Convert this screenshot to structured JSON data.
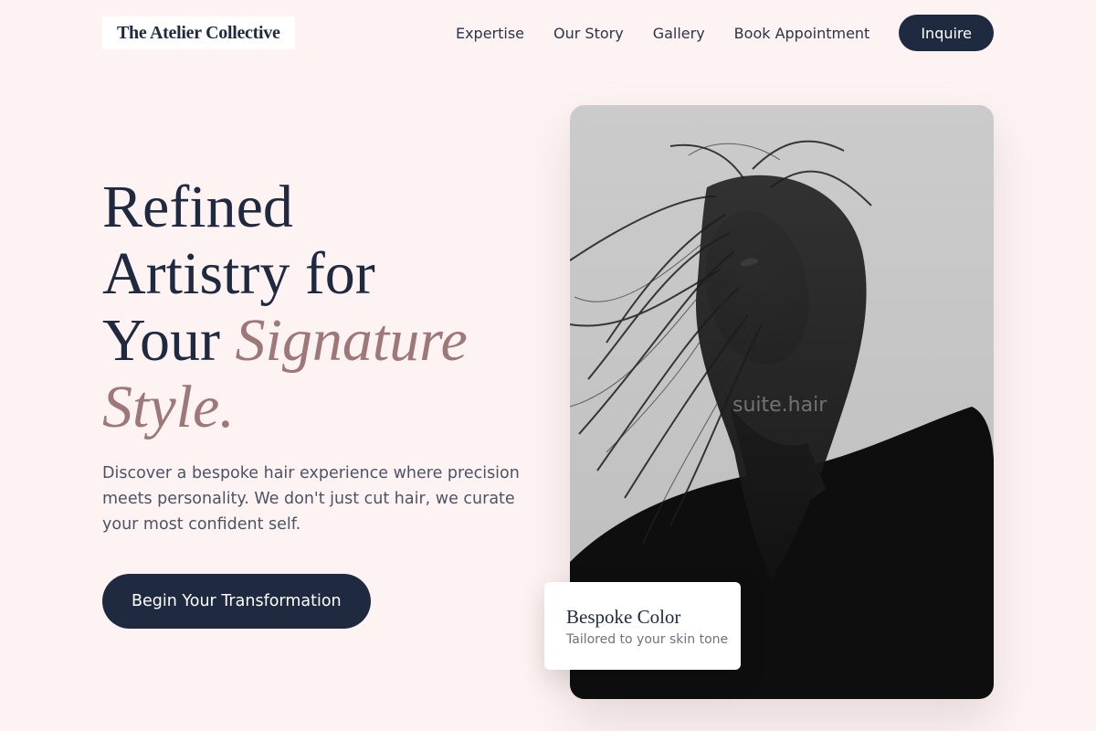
{
  "header": {
    "logo": "The Atelier Collective",
    "nav": [
      "Expertise",
      "Our Story",
      "Gallery",
      "Book Appointment"
    ],
    "cta_label": "Inquire"
  },
  "hero": {
    "title_lines": {
      "line1": "Refined",
      "line2": "Artistry for",
      "line3_plain": "Your ",
      "line3_accent": "Signature",
      "line4_accent": "Style."
    },
    "description": "Discover a bespoke hair experience where precision meets personality. We don't just cut hair, we curate your most confident self.",
    "cta_label": "Begin Your Transformation",
    "image_watermark": "suite.hair",
    "card": {
      "title": "Bespoke Color",
      "subtitle": "Tailored to your skin tone"
    }
  },
  "colors": {
    "background": "#fdf3f2",
    "primary": "#1f2a40",
    "accent": "#9e7879"
  }
}
